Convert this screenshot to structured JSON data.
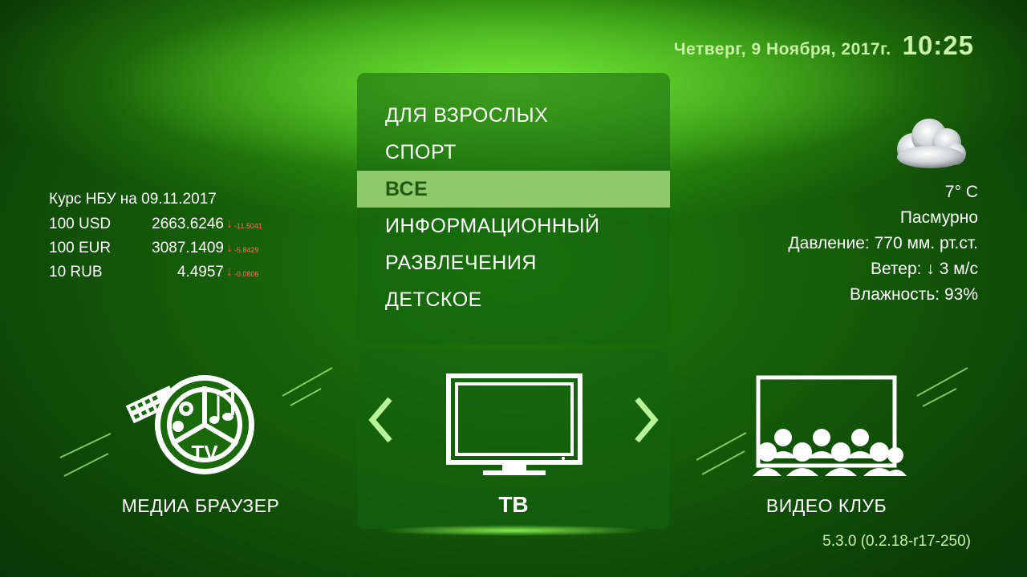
{
  "header": {
    "date": "Четверг, 9 Ноября, 2017г.",
    "time": "10:25"
  },
  "currency": {
    "title": "Курс НБУ на 09.11.2017",
    "rows": [
      {
        "name": "100 USD",
        "value": "2663.6246",
        "change": "-11.5041"
      },
      {
        "name": "100 EUR",
        "value": "3087.1409",
        "change": "-5.8429"
      },
      {
        "name": "10 RUB",
        "value": "4.4957",
        "change": "-0.0806"
      }
    ],
    "arrow": "↓",
    "change_color": "#ff4a3a"
  },
  "weather": {
    "icon": "cloud-icon",
    "temperature": "7° C",
    "condition": "Пасмурно",
    "pressure": "Давление: 770 мм. рт.ст.",
    "wind_label": "Ветер:",
    "wind_arrow": "↓",
    "wind_value": "3 м/с",
    "humidity": "Влажность: 93%"
  },
  "categories": {
    "items": [
      {
        "label": "ДЛЯ ВЗРОСЛЫХ"
      },
      {
        "label": "СПОРТ"
      },
      {
        "label": "ВСЕ"
      },
      {
        "label": "ИНФОРМАЦИОННЫЙ"
      },
      {
        "label": "РАЗВЛЕЧЕНИЯ"
      },
      {
        "label": "ДЕТСКОЕ"
      }
    ],
    "active_index": 2,
    "active_color": "#8ec96b"
  },
  "apps": {
    "left": {
      "label": "МЕДИА БРАУЗЕР",
      "icon": "media-browser-icon",
      "icon_text": "TV"
    },
    "center": {
      "label": "ТВ",
      "icon": "tv-icon"
    },
    "right": {
      "label": "ВИДЕО КЛУБ",
      "icon": "video-club-icon"
    }
  },
  "version": "5.3.0 (0.2.18-r17-250)",
  "colors": {
    "accent_text": "#c9f3a6",
    "arrow": "#b8f59a"
  }
}
